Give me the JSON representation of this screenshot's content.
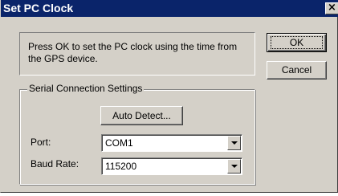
{
  "window": {
    "title": "Set PC Clock",
    "close_glyph": "×"
  },
  "info": {
    "text": "Press OK to set the PC clock using the time from the GPS device."
  },
  "buttons": {
    "ok_label": "OK",
    "cancel_label": "Cancel",
    "auto_detect_label": "Auto Detect..."
  },
  "serial": {
    "group_label": "Serial Connection Settings",
    "port_label": "Port:",
    "port_value": "COM1",
    "baud_label": "Baud Rate:",
    "baud_value": "115200"
  },
  "colors": {
    "titlebar": "#0a246a",
    "face": "#d4d0c8"
  },
  "icons": {
    "close": "close-icon",
    "dropdown": "chevron-down-icon"
  }
}
